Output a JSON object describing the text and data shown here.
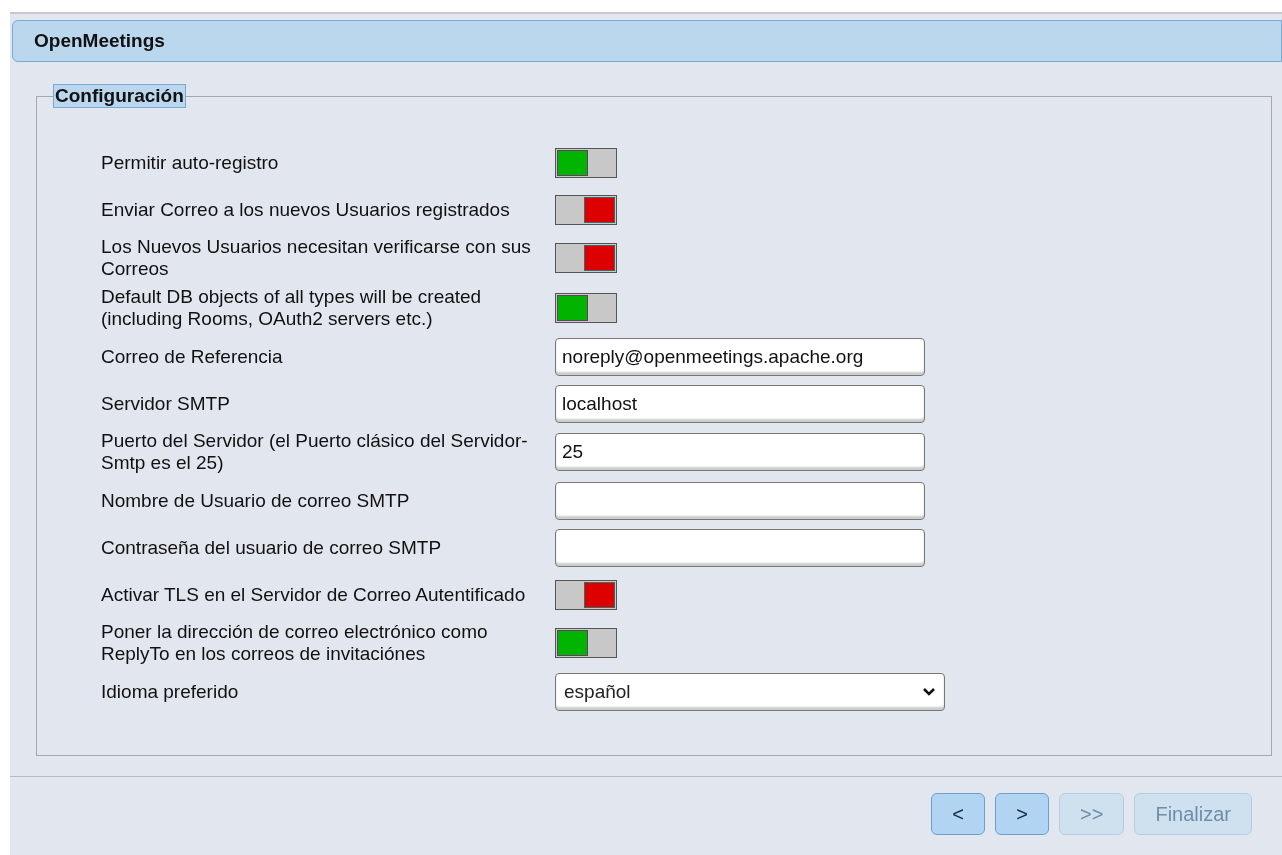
{
  "header": {
    "title": "OpenMeetings"
  },
  "fieldset": {
    "legend": "Configuración"
  },
  "rows": [
    {
      "kind": "toggle",
      "label": "Permitir auto-registro",
      "on": true
    },
    {
      "kind": "toggle",
      "label": "Enviar Correo a los nuevos Usuarios registrados",
      "on": false
    },
    {
      "kind": "toggle",
      "label": "Los Nuevos Usuarios necesitan verificarse con sus Correos",
      "on": false
    },
    {
      "kind": "toggle",
      "label": "Default DB objects of all types will be created (including Rooms, OAuth2 servers etc.)",
      "on": true
    },
    {
      "kind": "text",
      "label": "Correo de Referencia",
      "value": "noreply@openmeetings.apache.org"
    },
    {
      "kind": "text",
      "label": "Servidor SMTP",
      "value": "localhost"
    },
    {
      "kind": "text",
      "label": "Puerto del Servidor (el Puerto clásico del Servidor-Smtp es el 25)",
      "value": "25"
    },
    {
      "kind": "text",
      "label": "Nombre de Usuario de correo SMTP"
    },
    {
      "kind": "text",
      "label": "Contraseña del usuario de correo SMTP"
    },
    {
      "kind": "toggle",
      "label": "Activar TLS en el Servidor de Correo Autentificado",
      "on": false
    },
    {
      "kind": "toggle",
      "label": "Poner la dirección de correo electrónico como ReplyTo en los correos de invitaciónes",
      "on": true
    },
    {
      "kind": "select",
      "label": "Idioma preferido",
      "value": "español"
    }
  ],
  "buttons": [
    {
      "label": "<",
      "disabled": false
    },
    {
      "label": ">",
      "disabled": false
    },
    {
      "label": ">>",
      "disabled": true
    },
    {
      "label": "Finalizar",
      "disabled": true
    }
  ]
}
